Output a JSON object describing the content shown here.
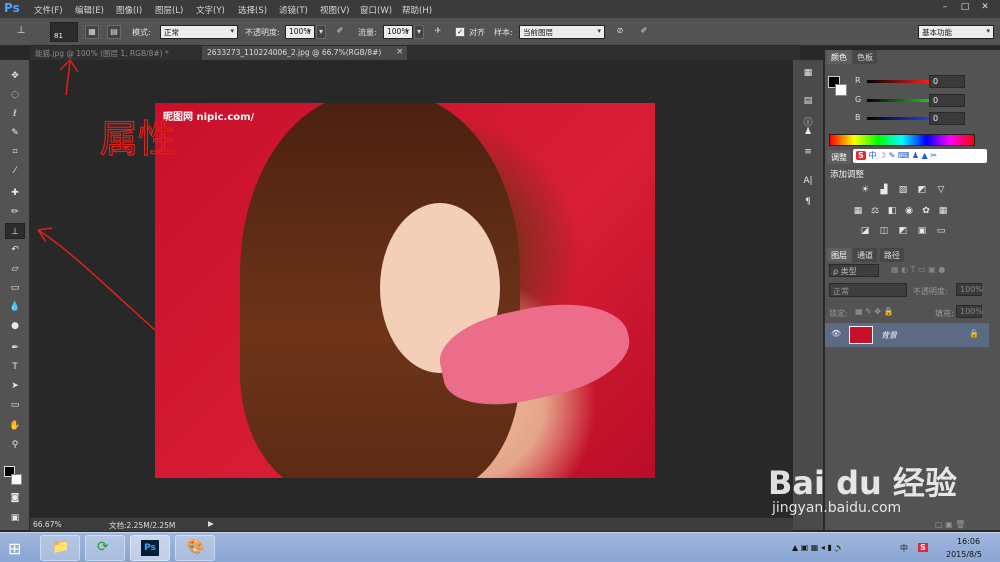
{
  "app": {
    "logo": "Ps"
  },
  "menu": [
    "文件(F)",
    "编辑(E)",
    "图像(I)",
    "图层(L)",
    "文字(Y)",
    "选择(S)",
    "滤镜(T)",
    "视图(V)",
    "窗口(W)",
    "帮助(H)"
  ],
  "window_controls": {
    "minimize": "–",
    "restore": "□",
    "close": "✕"
  },
  "options": {
    "brush_size": "81",
    "mode_label": "模式:",
    "mode_value": "正常",
    "opacity_label": "不透明度:",
    "opacity_value": "100%",
    "flow_label": "流量:",
    "flow_value": "100%",
    "align_label": "对齐",
    "sample_label": "样本:",
    "sample_value": "当前图层",
    "workspace": "基本功能"
  },
  "tabs": [
    {
      "label": "能猫.jpg @ 100% (图层 1, RGB/8#) *",
      "active": false
    },
    {
      "label": "2633273_110224006_2.jpg @ 66.7%(RGB/8#)",
      "active": true
    }
  ],
  "tab_close": "×",
  "canvas": {
    "image_watermark": "昵图网 nipic.com/"
  },
  "annotation": {
    "text": "属性",
    "color": "#e0201a"
  },
  "status": {
    "zoom": "66.67%",
    "doc_label": "文档:2.25M/2.25M"
  },
  "panels": {
    "color_tabs": [
      "颜色",
      "色板"
    ],
    "rgb": [
      {
        "label": "R",
        "value": "0",
        "color": "#e03030"
      },
      {
        "label": "G",
        "value": "0",
        "color": "#30b030"
      },
      {
        "label": "B",
        "value": "0",
        "color": "#3050e0"
      }
    ],
    "adjust_tab": "调整",
    "adjust_title": "添加调整",
    "layer_tabs": [
      "图层",
      "通道",
      "路径"
    ],
    "layer_filter": "ρ 类型",
    "blend_mode": "正常",
    "opacity_label": "不透明度:",
    "opacity_value": "100%",
    "lock_label": "锁定:",
    "fill_label": "填充:",
    "fill_value": "100%",
    "layer_name": "背景"
  },
  "taskbar": {
    "time": "16:06",
    "date": "2015/8/5",
    "ime": "中"
  },
  "brand_watermark": {
    "logo": "Bai du 经验",
    "url": "jingyan.baidu.com"
  }
}
